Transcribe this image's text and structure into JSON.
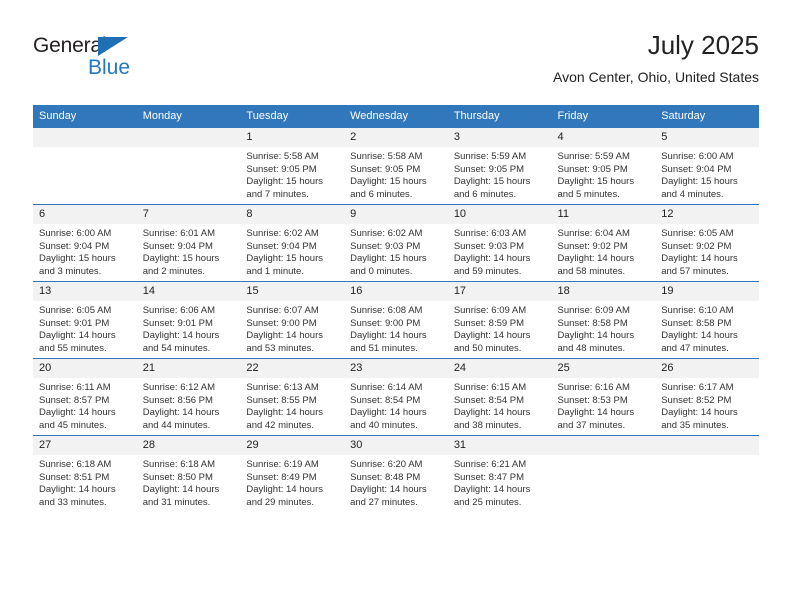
{
  "brand": {
    "name_part1": "General",
    "name_part2": "Blue",
    "triangle_icon": "triangle-icon",
    "color_black": "#231f20",
    "color_blue": "#2279c4"
  },
  "header": {
    "title": "July 2025",
    "subtitle": "Avon Center, Ohio, United States"
  },
  "theme": {
    "header_bg": "#3077bc",
    "daynum_bg": "#f2f2f2",
    "row_border": "#3077bc",
    "text": "#333333"
  },
  "weekday_headers": [
    "Sunday",
    "Monday",
    "Tuesday",
    "Wednesday",
    "Thursday",
    "Friday",
    "Saturday"
  ],
  "weeks": [
    [
      {
        "day": "",
        "empty": true,
        "sunrise": "",
        "sunset": "",
        "daylight_line1": "",
        "daylight_line2": ""
      },
      {
        "day": "",
        "empty": true,
        "sunrise": "",
        "sunset": "",
        "daylight_line1": "",
        "daylight_line2": ""
      },
      {
        "day": "1",
        "empty": false,
        "sunrise": "Sunrise: 5:58 AM",
        "sunset": "Sunset: 9:05 PM",
        "daylight_line1": "Daylight: 15 hours",
        "daylight_line2": "and 7 minutes."
      },
      {
        "day": "2",
        "empty": false,
        "sunrise": "Sunrise: 5:58 AM",
        "sunset": "Sunset: 9:05 PM",
        "daylight_line1": "Daylight: 15 hours",
        "daylight_line2": "and 6 minutes."
      },
      {
        "day": "3",
        "empty": false,
        "sunrise": "Sunrise: 5:59 AM",
        "sunset": "Sunset: 9:05 PM",
        "daylight_line1": "Daylight: 15 hours",
        "daylight_line2": "and 6 minutes."
      },
      {
        "day": "4",
        "empty": false,
        "sunrise": "Sunrise: 5:59 AM",
        "sunset": "Sunset: 9:05 PM",
        "daylight_line1": "Daylight: 15 hours",
        "daylight_line2": "and 5 minutes."
      },
      {
        "day": "5",
        "empty": false,
        "sunrise": "Sunrise: 6:00 AM",
        "sunset": "Sunset: 9:04 PM",
        "daylight_line1": "Daylight: 15 hours",
        "daylight_line2": "and 4 minutes."
      }
    ],
    [
      {
        "day": "6",
        "empty": false,
        "sunrise": "Sunrise: 6:00 AM",
        "sunset": "Sunset: 9:04 PM",
        "daylight_line1": "Daylight: 15 hours",
        "daylight_line2": "and 3 minutes."
      },
      {
        "day": "7",
        "empty": false,
        "sunrise": "Sunrise: 6:01 AM",
        "sunset": "Sunset: 9:04 PM",
        "daylight_line1": "Daylight: 15 hours",
        "daylight_line2": "and 2 minutes."
      },
      {
        "day": "8",
        "empty": false,
        "sunrise": "Sunrise: 6:02 AM",
        "sunset": "Sunset: 9:04 PM",
        "daylight_line1": "Daylight: 15 hours",
        "daylight_line2": "and 1 minute."
      },
      {
        "day": "9",
        "empty": false,
        "sunrise": "Sunrise: 6:02 AM",
        "sunset": "Sunset: 9:03 PM",
        "daylight_line1": "Daylight: 15 hours",
        "daylight_line2": "and 0 minutes."
      },
      {
        "day": "10",
        "empty": false,
        "sunrise": "Sunrise: 6:03 AM",
        "sunset": "Sunset: 9:03 PM",
        "daylight_line1": "Daylight: 14 hours",
        "daylight_line2": "and 59 minutes."
      },
      {
        "day": "11",
        "empty": false,
        "sunrise": "Sunrise: 6:04 AM",
        "sunset": "Sunset: 9:02 PM",
        "daylight_line1": "Daylight: 14 hours",
        "daylight_line2": "and 58 minutes."
      },
      {
        "day": "12",
        "empty": false,
        "sunrise": "Sunrise: 6:05 AM",
        "sunset": "Sunset: 9:02 PM",
        "daylight_line1": "Daylight: 14 hours",
        "daylight_line2": "and 57 minutes."
      }
    ],
    [
      {
        "day": "13",
        "empty": false,
        "sunrise": "Sunrise: 6:05 AM",
        "sunset": "Sunset: 9:01 PM",
        "daylight_line1": "Daylight: 14 hours",
        "daylight_line2": "and 55 minutes."
      },
      {
        "day": "14",
        "empty": false,
        "sunrise": "Sunrise: 6:06 AM",
        "sunset": "Sunset: 9:01 PM",
        "daylight_line1": "Daylight: 14 hours",
        "daylight_line2": "and 54 minutes."
      },
      {
        "day": "15",
        "empty": false,
        "sunrise": "Sunrise: 6:07 AM",
        "sunset": "Sunset: 9:00 PM",
        "daylight_line1": "Daylight: 14 hours",
        "daylight_line2": "and 53 minutes."
      },
      {
        "day": "16",
        "empty": false,
        "sunrise": "Sunrise: 6:08 AM",
        "sunset": "Sunset: 9:00 PM",
        "daylight_line1": "Daylight: 14 hours",
        "daylight_line2": "and 51 minutes."
      },
      {
        "day": "17",
        "empty": false,
        "sunrise": "Sunrise: 6:09 AM",
        "sunset": "Sunset: 8:59 PM",
        "daylight_line1": "Daylight: 14 hours",
        "daylight_line2": "and 50 minutes."
      },
      {
        "day": "18",
        "empty": false,
        "sunrise": "Sunrise: 6:09 AM",
        "sunset": "Sunset: 8:58 PM",
        "daylight_line1": "Daylight: 14 hours",
        "daylight_line2": "and 48 minutes."
      },
      {
        "day": "19",
        "empty": false,
        "sunrise": "Sunrise: 6:10 AM",
        "sunset": "Sunset: 8:58 PM",
        "daylight_line1": "Daylight: 14 hours",
        "daylight_line2": "and 47 minutes."
      }
    ],
    [
      {
        "day": "20",
        "empty": false,
        "sunrise": "Sunrise: 6:11 AM",
        "sunset": "Sunset: 8:57 PM",
        "daylight_line1": "Daylight: 14 hours",
        "daylight_line2": "and 45 minutes."
      },
      {
        "day": "21",
        "empty": false,
        "sunrise": "Sunrise: 6:12 AM",
        "sunset": "Sunset: 8:56 PM",
        "daylight_line1": "Daylight: 14 hours",
        "daylight_line2": "and 44 minutes."
      },
      {
        "day": "22",
        "empty": false,
        "sunrise": "Sunrise: 6:13 AM",
        "sunset": "Sunset: 8:55 PM",
        "daylight_line1": "Daylight: 14 hours",
        "daylight_line2": "and 42 minutes."
      },
      {
        "day": "23",
        "empty": false,
        "sunrise": "Sunrise: 6:14 AM",
        "sunset": "Sunset: 8:54 PM",
        "daylight_line1": "Daylight: 14 hours",
        "daylight_line2": "and 40 minutes."
      },
      {
        "day": "24",
        "empty": false,
        "sunrise": "Sunrise: 6:15 AM",
        "sunset": "Sunset: 8:54 PM",
        "daylight_line1": "Daylight: 14 hours",
        "daylight_line2": "and 38 minutes."
      },
      {
        "day": "25",
        "empty": false,
        "sunrise": "Sunrise: 6:16 AM",
        "sunset": "Sunset: 8:53 PM",
        "daylight_line1": "Daylight: 14 hours",
        "daylight_line2": "and 37 minutes."
      },
      {
        "day": "26",
        "empty": false,
        "sunrise": "Sunrise: 6:17 AM",
        "sunset": "Sunset: 8:52 PM",
        "daylight_line1": "Daylight: 14 hours",
        "daylight_line2": "and 35 minutes."
      }
    ],
    [
      {
        "day": "27",
        "empty": false,
        "sunrise": "Sunrise: 6:18 AM",
        "sunset": "Sunset: 8:51 PM",
        "daylight_line1": "Daylight: 14 hours",
        "daylight_line2": "and 33 minutes."
      },
      {
        "day": "28",
        "empty": false,
        "sunrise": "Sunrise: 6:18 AM",
        "sunset": "Sunset: 8:50 PM",
        "daylight_line1": "Daylight: 14 hours",
        "daylight_line2": "and 31 minutes."
      },
      {
        "day": "29",
        "empty": false,
        "sunrise": "Sunrise: 6:19 AM",
        "sunset": "Sunset: 8:49 PM",
        "daylight_line1": "Daylight: 14 hours",
        "daylight_line2": "and 29 minutes."
      },
      {
        "day": "30",
        "empty": false,
        "sunrise": "Sunrise: 6:20 AM",
        "sunset": "Sunset: 8:48 PM",
        "daylight_line1": "Daylight: 14 hours",
        "daylight_line2": "and 27 minutes."
      },
      {
        "day": "31",
        "empty": false,
        "sunrise": "Sunrise: 6:21 AM",
        "sunset": "Sunset: 8:47 PM",
        "daylight_line1": "Daylight: 14 hours",
        "daylight_line2": "and 25 minutes."
      },
      {
        "day": "",
        "empty": true,
        "sunrise": "",
        "sunset": "",
        "daylight_line1": "",
        "daylight_line2": ""
      },
      {
        "day": "",
        "empty": true,
        "sunrise": "",
        "sunset": "",
        "daylight_line1": "",
        "daylight_line2": ""
      }
    ]
  ]
}
